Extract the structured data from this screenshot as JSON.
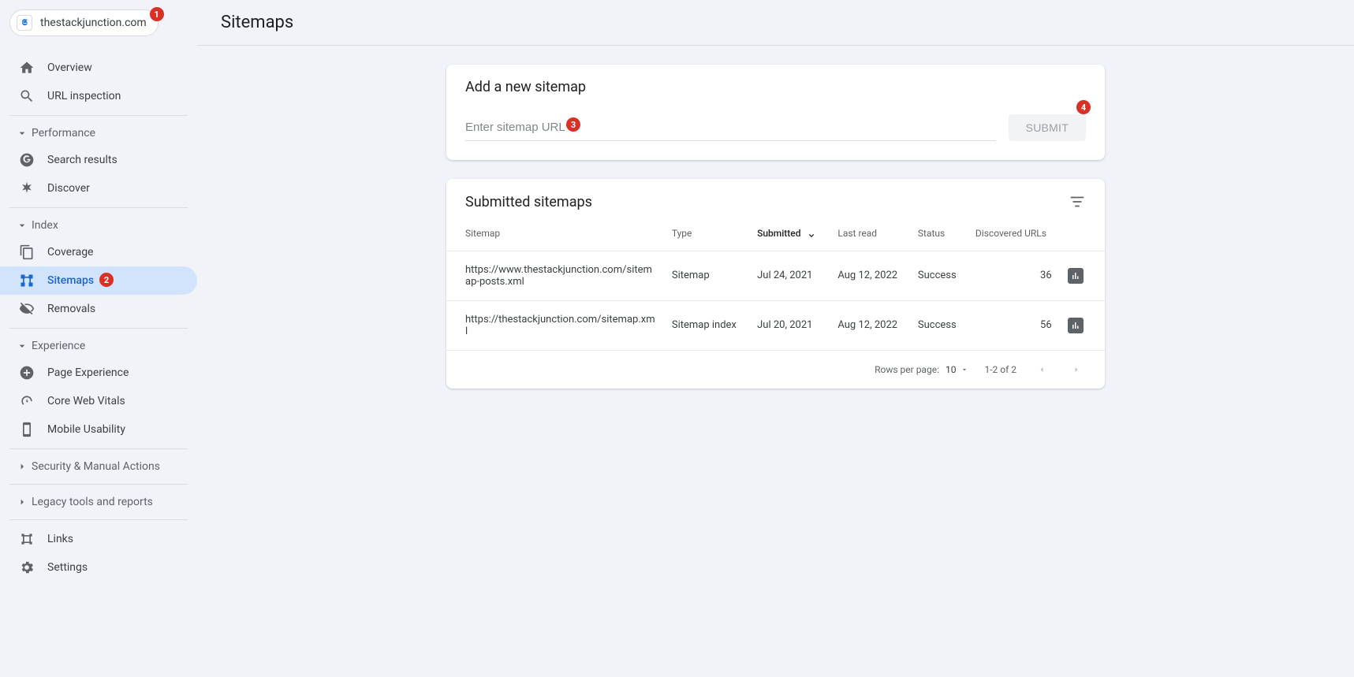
{
  "property": {
    "domain": "thestackjunction.com",
    "favicon_letter": "𝕾"
  },
  "annotations": {
    "a1": "1",
    "a2": "2",
    "a3": "3",
    "a4": "4"
  },
  "nav": {
    "overview": "Overview",
    "url_inspection": "URL inspection",
    "performance": "Performance",
    "search_results": "Search results",
    "discover": "Discover",
    "index": "Index",
    "coverage": "Coverage",
    "sitemaps": "Sitemaps",
    "removals": "Removals",
    "experience": "Experience",
    "page_experience": "Page Experience",
    "core_web_vitals": "Core Web Vitals",
    "mobile_usability": "Mobile Usability",
    "security": "Security & Manual Actions",
    "legacy": "Legacy tools and reports",
    "links": "Links",
    "settings": "Settings"
  },
  "page": {
    "title": "Sitemaps"
  },
  "add_card": {
    "title": "Add a new sitemap",
    "placeholder": "Enter sitemap URL",
    "submit": "SUBMIT"
  },
  "list_card": {
    "title": "Submitted sitemaps",
    "columns": {
      "sitemap": "Sitemap",
      "type": "Type",
      "submitted": "Submitted",
      "last_read": "Last read",
      "status": "Status",
      "discovered": "Discovered URLs"
    },
    "rows": [
      {
        "url": "https://www.thestackjunction.com/sitemap-posts.xml",
        "type": "Sitemap",
        "submitted": "Jul 24, 2021",
        "last_read": "Aug 12, 2022",
        "status": "Success",
        "discovered": "36"
      },
      {
        "url": "https://thestackjunction.com/sitemap.xml",
        "type": "Sitemap index",
        "submitted": "Jul 20, 2021",
        "last_read": "Aug 12, 2022",
        "status": "Success",
        "discovered": "56"
      }
    ],
    "pagination": {
      "rows_label": "Rows per page:",
      "page_size": "10",
      "range": "1-2 of 2"
    }
  }
}
